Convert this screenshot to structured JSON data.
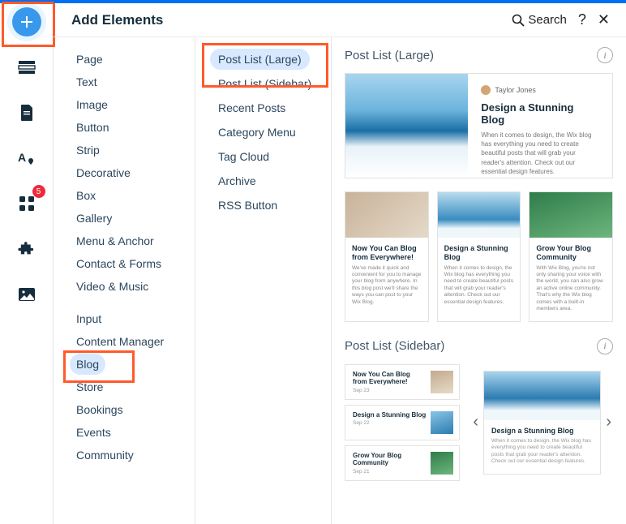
{
  "toolbar": {
    "add_badge": "5"
  },
  "header": {
    "title": "Add Elements",
    "search_label": "Search",
    "help_label": "?",
    "close_label": "✕"
  },
  "categories": {
    "group1": [
      "Page",
      "Text",
      "Image",
      "Button",
      "Strip",
      "Decorative",
      "Box",
      "Gallery",
      "Menu & Anchor",
      "Contact & Forms",
      "Video & Music"
    ],
    "group2": [
      "Input",
      "Content Manager",
      "Blog",
      "Store",
      "Bookings",
      "Events",
      "Community"
    ],
    "selected": "Blog"
  },
  "subcategories": {
    "items": [
      "Post List (Large)",
      "Post List (Sidebar)",
      "Recent Posts",
      "Category Menu",
      "Tag Cloud",
      "Archive",
      "RSS Button"
    ],
    "selected": "Post List (Large)"
  },
  "preview": {
    "section1_title": "Post List (Large)",
    "big_card": {
      "author": "Taylor Jones",
      "title": "Design a Stunning Blog",
      "body": "When it comes to design, the Wix blog has everything you need to create beautiful posts that will grab your reader's attention. Check out our essential design features."
    },
    "tri": [
      {
        "title": "Now You Can Blog from Everywhere!",
        "body": "We've made it quick and convenient for you to manage your blog from anywhere. In this blog post we'll share the ways you can post to your Wix Blog."
      },
      {
        "title": "Design a Stunning Blog",
        "body": "When it comes to design, the Wix blog has everything you need to create beautiful posts that will grab your reader's attention. Check out our essential design features."
      },
      {
        "title": "Grow Your Blog Community",
        "body": "With Wix Blog, you're not only sharing your voice with the world, you can also grow an active online community. That's why the Wix blog comes with a built-in members area."
      }
    ],
    "section2_title": "Post List (Sidebar)",
    "side_items": [
      {
        "title": "Now You Can Blog from Everywhere!",
        "date": "Sep 23"
      },
      {
        "title": "Design a Stunning Blog",
        "date": "Sep 22"
      },
      {
        "title": "Grow Your Blog Community",
        "date": "Sep 21"
      }
    ],
    "carousel_card": {
      "title": "Design a Stunning Blog",
      "body": "When it comes to design, the Wix blog has everything you need to create beautiful posts that grab your reader's attention. Check out our essential design features."
    }
  }
}
